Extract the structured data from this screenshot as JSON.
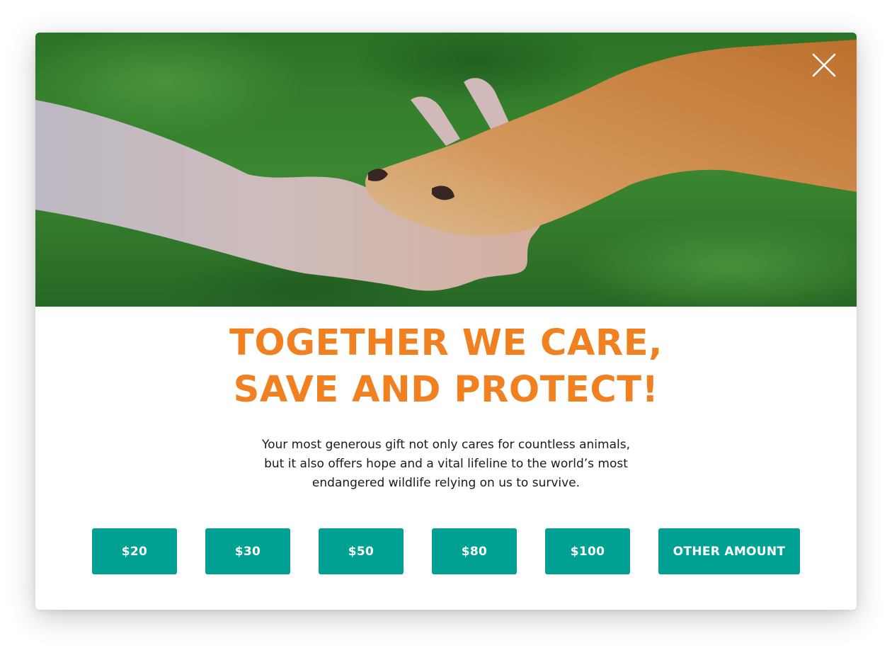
{
  "modal": {
    "headline_line1": "TOGETHER WE CARE,",
    "headline_line2": "SAVE AND PROTECT!",
    "body_line1": "Your most generous gift not only cares for countless animals,",
    "body_line2": "but it also offers hope and a vital lifeline to the world’s most",
    "body_line3": "endangered wildlife relying on us to survive.",
    "close_icon": "close-icon",
    "hero_image": "hand-and-dog-paw-photo"
  },
  "donation": {
    "amounts": [
      "$20",
      "$30",
      "$50",
      "$80",
      "$100"
    ],
    "other_label": "OTHER AMOUNT"
  },
  "colors": {
    "accent": "#f18021",
    "button": "#00a193",
    "button_text": "#ffffff",
    "body_text": "#1a1a1a"
  }
}
